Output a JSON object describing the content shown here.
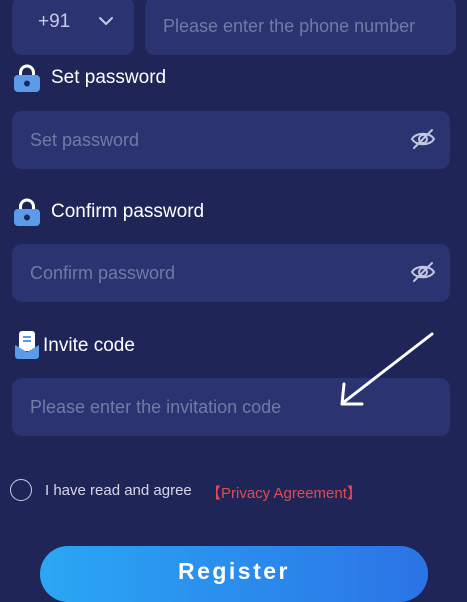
{
  "phone": {
    "country_code": "+91",
    "placeholder": "Please enter the phone number"
  },
  "set_password": {
    "label": "Set password",
    "placeholder": "Set password"
  },
  "confirm_password": {
    "label": "Confirm password",
    "placeholder": "Confirm password"
  },
  "invite_code": {
    "label": "Invite code",
    "placeholder": "Please enter the invitation code"
  },
  "agreement": {
    "text": "I have read and agree",
    "link": "【Privacy Agreement】"
  },
  "register": {
    "label": "Register"
  },
  "icons": {
    "lock": "lock-icon",
    "eye_off": "eye-off-icon",
    "invite": "invite-code-icon",
    "chevron": "chevron-down-icon",
    "arrow": "arrow-annotation"
  },
  "colors": {
    "background": "#1f2657",
    "field": "#2b3470",
    "placeholder": "#737aa6",
    "link": "#e24a53",
    "button_start": "#2aa7f4",
    "button_end": "#2b73e6"
  }
}
